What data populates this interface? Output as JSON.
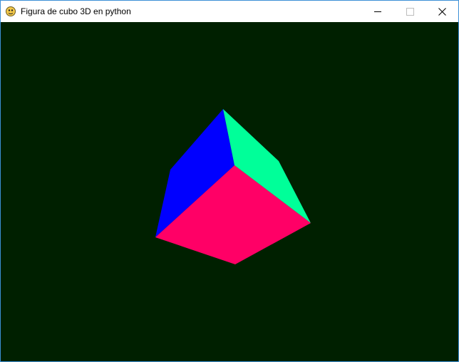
{
  "window": {
    "title": "Figura de cubo 3D en python",
    "icon": "pygame-snake-icon",
    "controls": [
      "minimize-icon",
      "maximize-icon",
      "close-icon"
    ]
  },
  "scene": {
    "background_color": "#002000",
    "object": "cube",
    "faces": [
      {
        "name": "left-face",
        "color": "#0000ff"
      },
      {
        "name": "right-face",
        "color": "#00ff99"
      },
      {
        "name": "front-face",
        "color": "#ff0066"
      }
    ]
  }
}
